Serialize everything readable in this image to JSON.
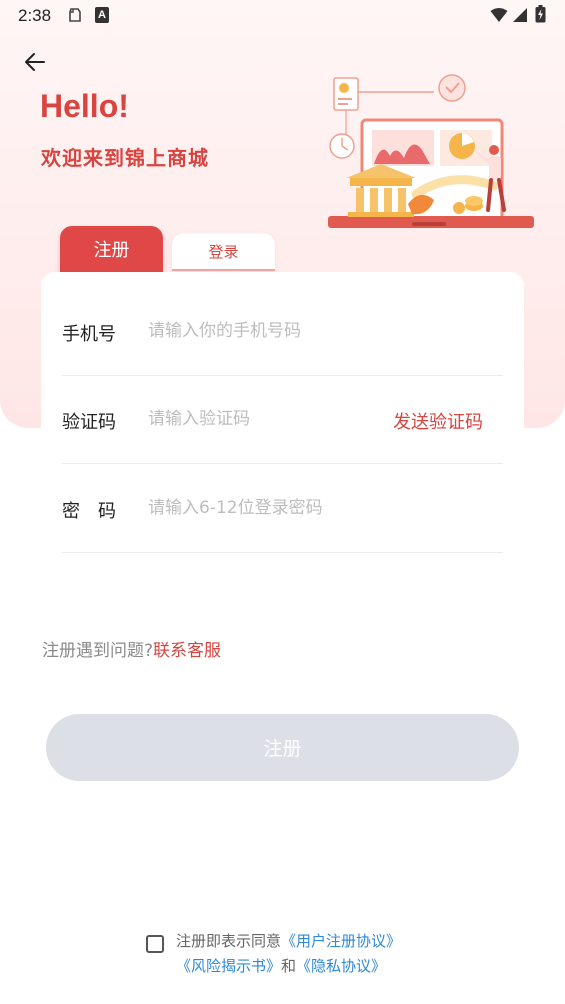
{
  "status_bar": {
    "time": "2:38",
    "icons": [
      "notification-icon",
      "a-app-icon",
      "wifi-icon",
      "signal-icon",
      "battery-icon"
    ],
    "a_app_glyph": "A"
  },
  "header": {
    "back_icon": "back-arrow-icon",
    "hello": "Hello!",
    "welcome": "欢迎来到锦上商城"
  },
  "tabs": [
    {
      "label": "注册",
      "active": true
    },
    {
      "label": "登录",
      "active": false
    }
  ],
  "form": {
    "phone": {
      "label": "手机号",
      "placeholder": "请输入你的手机号码",
      "value": ""
    },
    "code": {
      "label": "验证码",
      "placeholder": "请输入验证码",
      "value": "",
      "send_label": "发送验证码"
    },
    "password": {
      "label": "密　码",
      "placeholder": "请输入6-12位登录密码",
      "value": ""
    }
  },
  "help": {
    "question": "注册遇到问题?",
    "link": "联系客服"
  },
  "register_button": "注册",
  "agreement": {
    "checked": false,
    "text1": "注册即表示同意",
    "link1": "《用户注册协议》",
    "link2": "《风险揭示书》",
    "and": "和",
    "link3": "《隐私协议》"
  },
  "colors": {
    "accent": "#d8443f",
    "tab_active_bg": "#e04848",
    "button_disabled": "#dcdfe6",
    "link": "#2e88d8"
  }
}
